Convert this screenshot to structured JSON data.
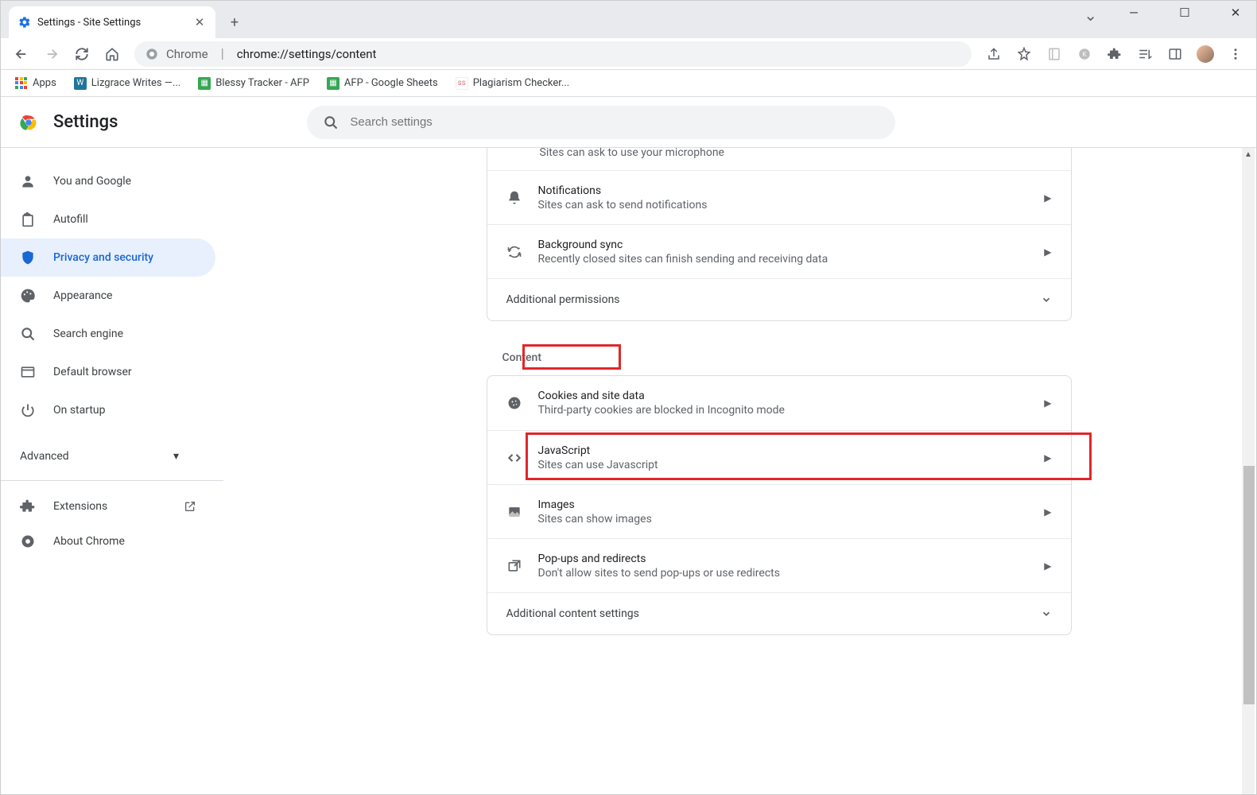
{
  "window": {
    "tab_title": "Settings - Site Settings"
  },
  "omnibox": {
    "prefix": "Chrome",
    "url": "chrome://settings/content"
  },
  "bookmarks": {
    "apps": "Apps",
    "items": [
      "Lizgrace Writes —...",
      "Blessy Tracker - AFP",
      "AFP - Google Sheets",
      "Plagiarism Checker..."
    ]
  },
  "settings": {
    "title": "Settings",
    "search_placeholder": "Search settings"
  },
  "sidebar": {
    "items": [
      "You and Google",
      "Autofill",
      "Privacy and security",
      "Appearance",
      "Search engine",
      "Default browser",
      "On startup"
    ],
    "advanced": "Advanced",
    "extensions": "Extensions",
    "about": "About Chrome"
  },
  "content": {
    "partial_sub": "Sites can ask to use your microphone",
    "rows_top": [
      {
        "title": "Notifications",
        "sub": "Sites can ask to send notifications"
      },
      {
        "title": "Background sync",
        "sub": "Recently closed sites can finish sending and receiving data"
      }
    ],
    "additional_permissions": "Additional permissions",
    "section_label": "Content",
    "rows_content": [
      {
        "title": "Cookies and site data",
        "sub": "Third-party cookies are blocked in Incognito mode"
      },
      {
        "title": "JavaScript",
        "sub": "Sites can use Javascript"
      },
      {
        "title": "Images",
        "sub": "Sites can show images"
      },
      {
        "title": "Pop-ups and redirects",
        "sub": "Don't allow sites to send pop-ups or use redirects"
      }
    ],
    "additional_content": "Additional content settings"
  }
}
